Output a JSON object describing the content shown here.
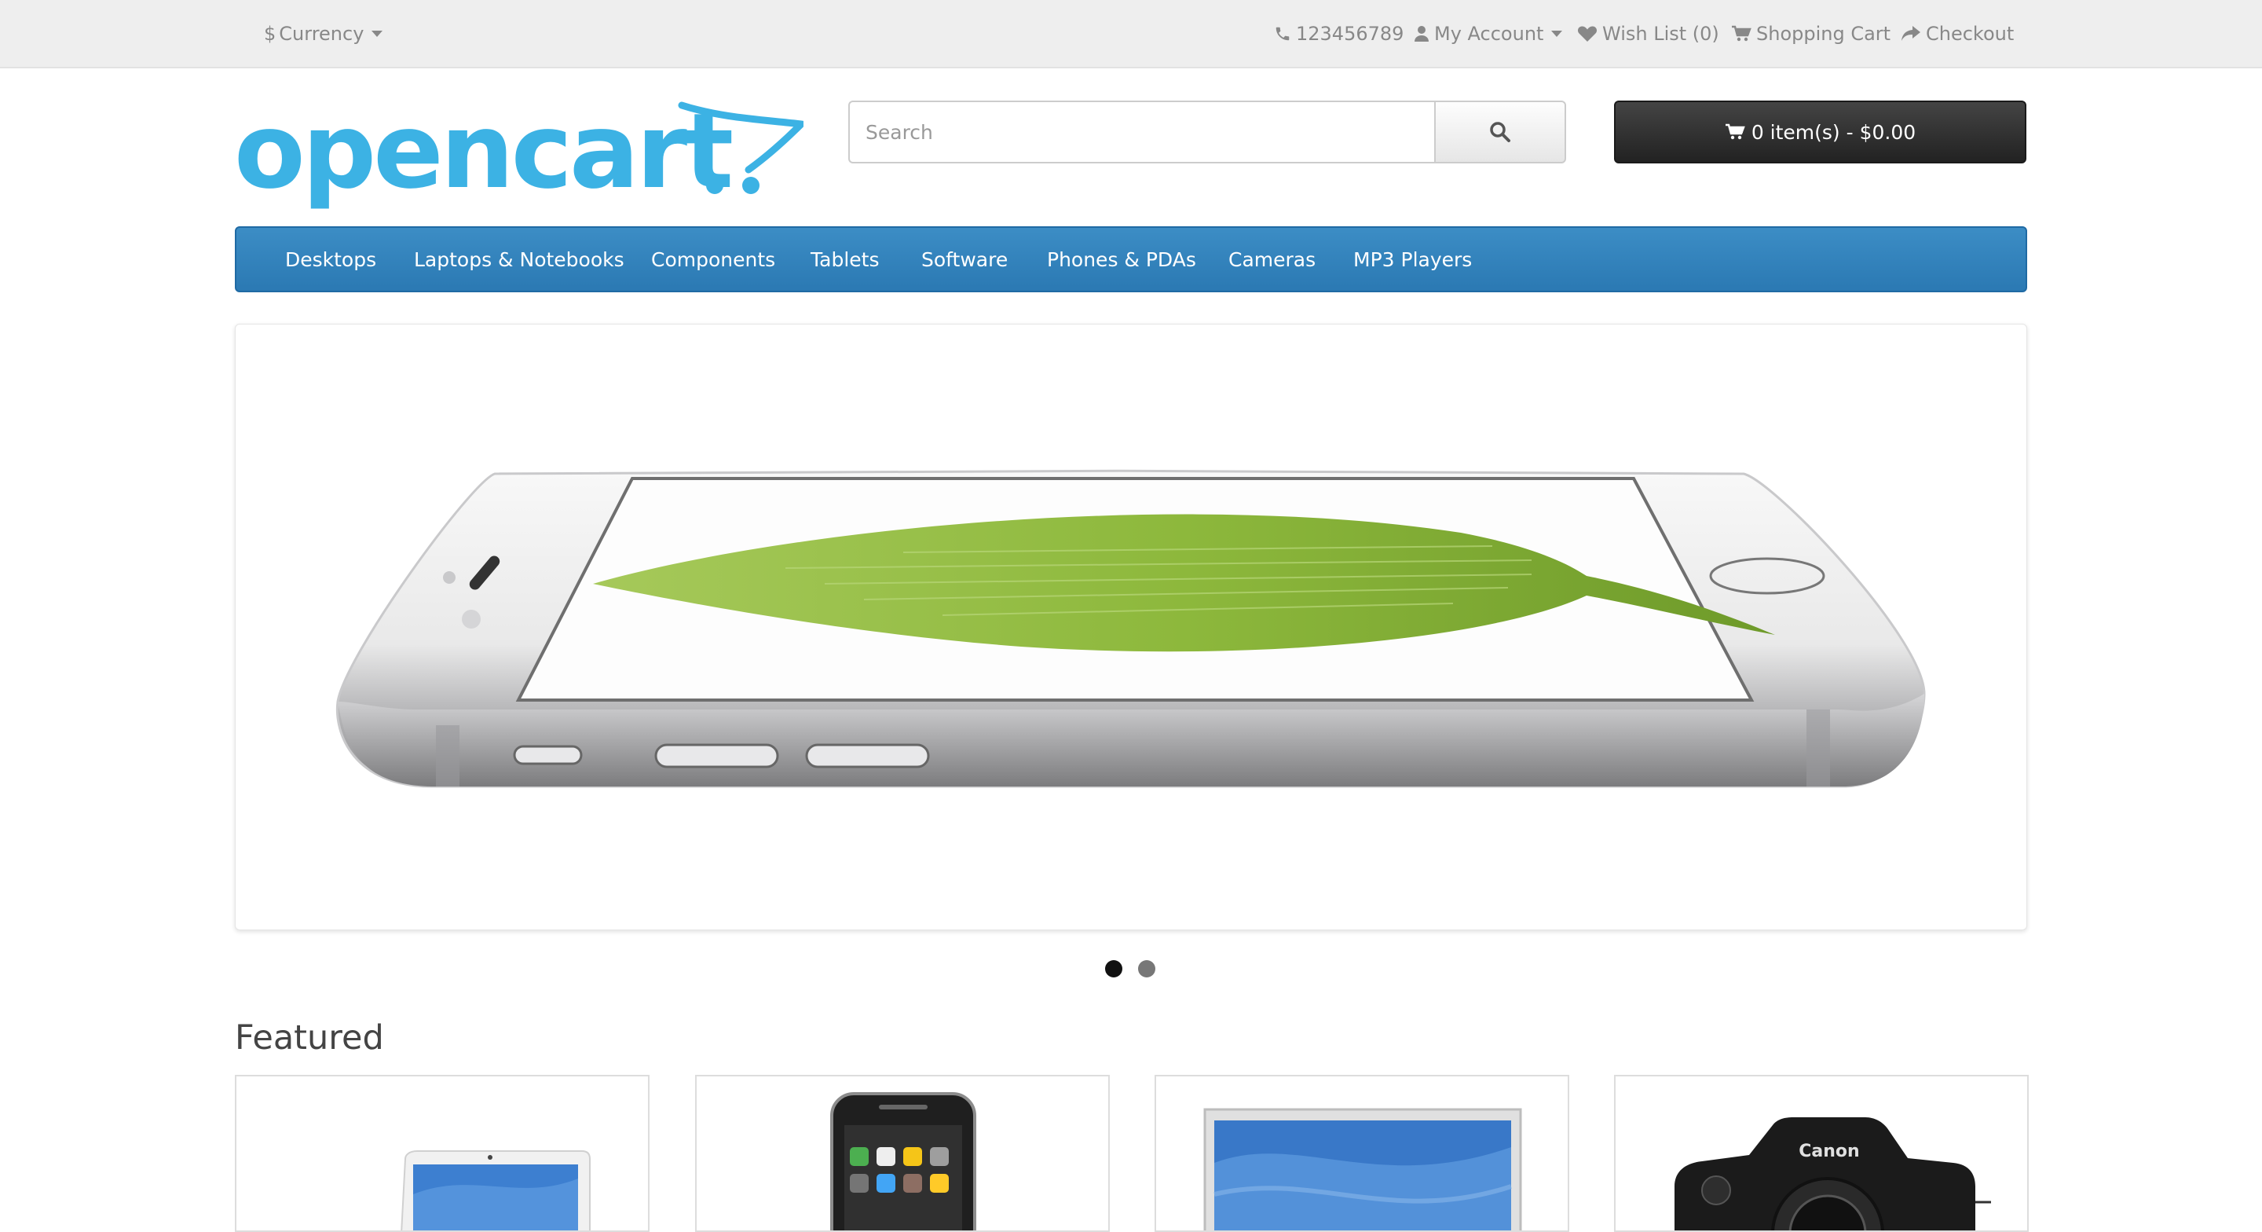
{
  "topbar": {
    "currency_label": "Currency",
    "phone": "123456789",
    "my_account": "My Account",
    "wish_list": "Wish List (0)",
    "shopping_cart": "Shopping Cart",
    "checkout": "Checkout"
  },
  "header": {
    "logo_text": "opencart",
    "search_placeholder": "Search",
    "cart_label": "0 item(s) - $0.00"
  },
  "menu": {
    "items": [
      {
        "label": "Desktops"
      },
      {
        "label": "Laptops & Notebooks"
      },
      {
        "label": "Components"
      },
      {
        "label": "Tablets"
      },
      {
        "label": "Software"
      },
      {
        "label": "Phones & PDAs"
      },
      {
        "label": "Cameras"
      },
      {
        "label": "MP3 Players"
      }
    ]
  },
  "slideshow": {
    "slide_count": 2,
    "active_slide": 1
  },
  "featured": {
    "title": "Featured",
    "products": [
      {
        "image": "laptop-image",
        "canon_label": ""
      },
      {
        "image": "iphone-image",
        "canon_label": ""
      },
      {
        "image": "monitor-image",
        "canon_label": ""
      },
      {
        "image": "camera-image",
        "canon_label": "Canon"
      }
    ]
  },
  "colors": {
    "menu_blue": "#3283be",
    "logo_blue": "#3cb2e4",
    "cart_dark": "#2b2b2b",
    "topbar_bg": "#eeeeee"
  }
}
